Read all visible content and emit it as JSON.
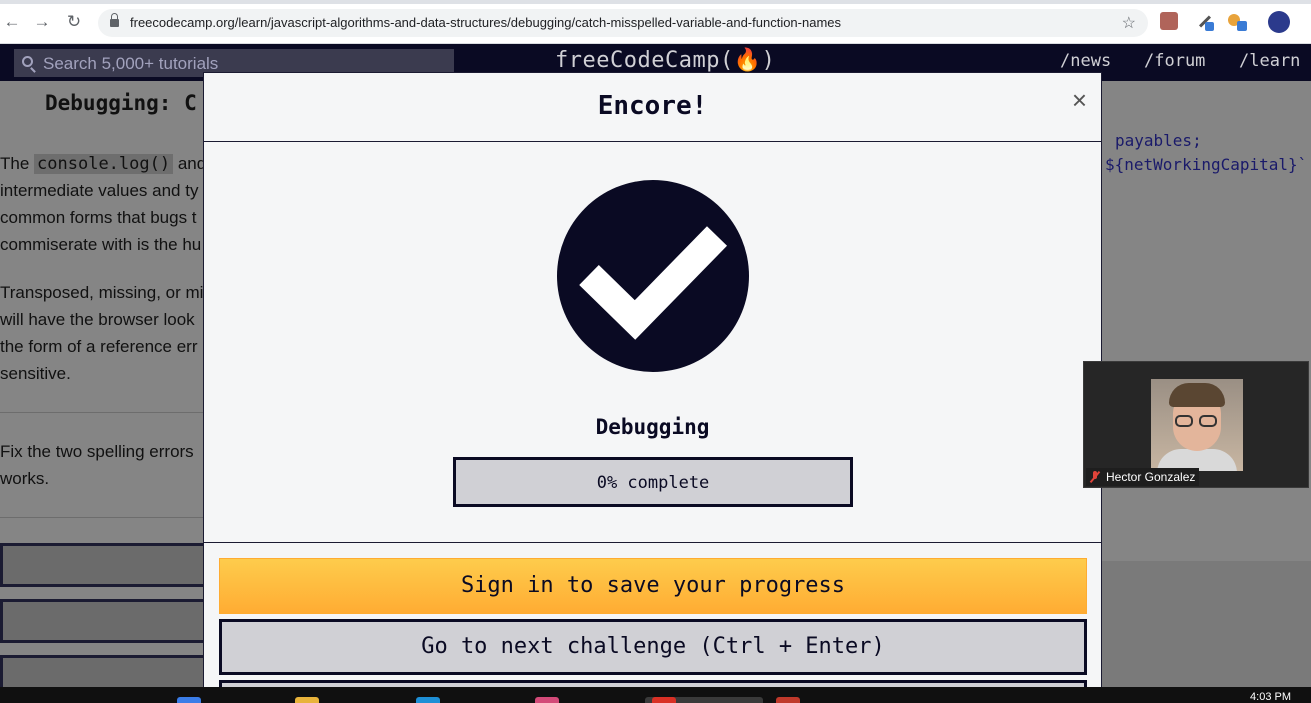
{
  "browser": {
    "url": "freecodecamp.org/learn/javascript-algorithms-and-data-structures/debugging/catch-misspelled-variable-and-function-names",
    "back_icon": "arrow-left-icon",
    "forward_icon": "arrow-right-icon",
    "reload_icon": "reload-icon"
  },
  "nav": {
    "search_placeholder": "Search 5,000+ tutorials",
    "logo": "freeCodeCamp(🔥)",
    "links": [
      "/news",
      "/forum",
      "/learn"
    ]
  },
  "lesson": {
    "title": "Debugging: C",
    "p1": [
      "The",
      "console.log()",
      "and",
      "intermediate values and ty",
      "common forms that bugs t",
      "commiserate with is the hu"
    ],
    "p2": [
      "Transposed, missing, or mi",
      "will have the browser look",
      "the form of a reference err",
      "sensitive."
    ],
    "p3": [
      "Fix the two spelling errors",
      "works."
    ]
  },
  "editor": {
    "line1": "payables;",
    "line2": "${netWorkingCapital}`"
  },
  "modal": {
    "title": "Encore!",
    "close_label": "×",
    "certification": "Debugging",
    "progress_percent": 0,
    "progress_text": "0% complete",
    "signin_label": "Sign in to save your progress",
    "next_label": "Go to next challenge (Ctrl + Enter)"
  },
  "video": {
    "participant_name": "Hector Gonzalez",
    "muted": true
  },
  "taskbar": {
    "clock": "4:03 PM"
  },
  "colors": {
    "nav_bg": "#0a0a23",
    "modal_bg": "#f5f6f7",
    "signin_button": "#ffac33",
    "check_circle": "#0a0a23"
  }
}
